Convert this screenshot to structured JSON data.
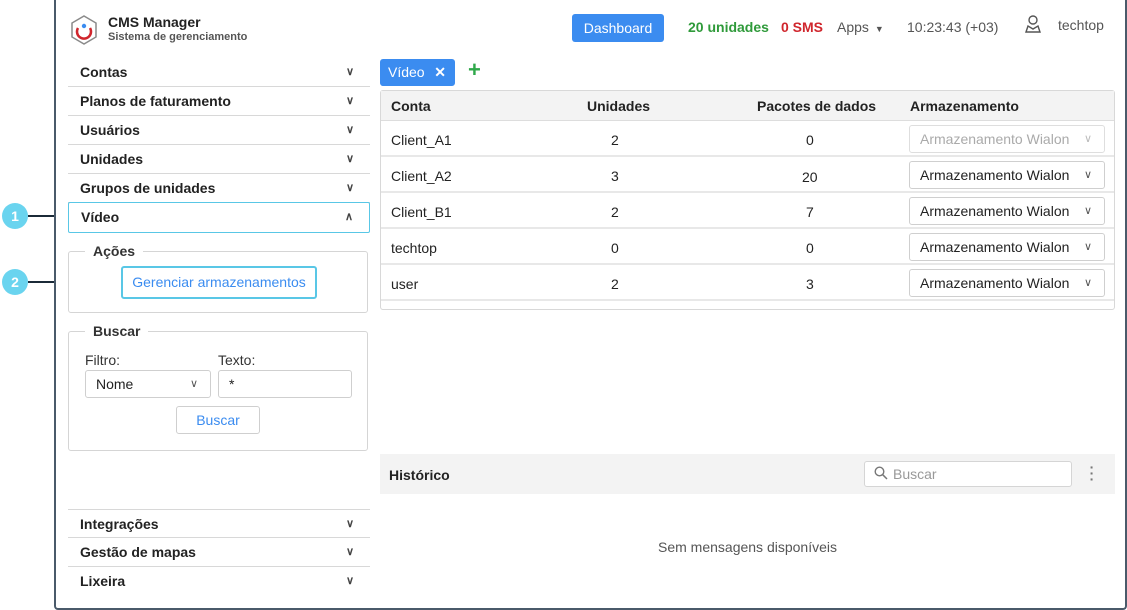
{
  "header": {
    "app_title": "CMS Manager",
    "app_subtitle": "Sistema de gerenciamento",
    "dashboard_label": "Dashboard",
    "units_label": "20 unidades",
    "sms_label": "0 SMS",
    "apps_label": "Apps",
    "clock": "10:23:43 (+03)",
    "user_name": "techtop"
  },
  "sidebar": {
    "items": [
      {
        "label": "Contas"
      },
      {
        "label": "Planos de faturamento"
      },
      {
        "label": "Usuários"
      },
      {
        "label": "Unidades"
      },
      {
        "label": "Grupos de unidades"
      },
      {
        "label": "Vídeo"
      }
    ],
    "bottom_items": [
      {
        "label": "Integrações"
      },
      {
        "label": "Gestão de mapas"
      },
      {
        "label": "Lixeira"
      }
    ],
    "actions": {
      "legend": "Ações",
      "manage_button": "Gerenciar armazenamentos"
    },
    "search": {
      "legend": "Buscar",
      "filter_label": "Filtro:",
      "filter_value": "Nome",
      "text_label": "Texto:",
      "text_value": "*",
      "button": "Buscar"
    }
  },
  "main": {
    "tab_label": "Vídeo",
    "tab_close": "✕",
    "add_tab": "+",
    "table": {
      "headers": [
        "Conta",
        "Unidades",
        "Pacotes de dados",
        "Armazenamento"
      ],
      "rows": [
        {
          "account": "Client_A1",
          "units": "2",
          "packets": "0",
          "storage": "Armazenamento Wialon",
          "disabled": true
        },
        {
          "account": "Client_A2",
          "units": "3",
          "packets": "20",
          "storage": "Armazenamento Wialon",
          "disabled": false
        },
        {
          "account": "Client_B1",
          "units": "2",
          "packets": "7",
          "storage": "Armazenamento Wialon",
          "disabled": false
        },
        {
          "account": "techtop",
          "units": "0",
          "packets": "0",
          "storage": "Armazenamento Wialon",
          "disabled": false
        },
        {
          "account": "user",
          "units": "2",
          "packets": "3",
          "storage": "Armazenamento Wialon",
          "disabled": false
        }
      ]
    },
    "history": {
      "title": "Histórico",
      "search_placeholder": "Buscar",
      "empty_message": "Sem mensagens disponíveis"
    }
  },
  "callouts": [
    "1",
    "2"
  ],
  "colors": {
    "accent": "#3b8cf0",
    "units_green": "#2f9a3a",
    "sms_red": "#d0262d",
    "highlight": "#59c7e6",
    "callout": "#6ad4ef"
  }
}
